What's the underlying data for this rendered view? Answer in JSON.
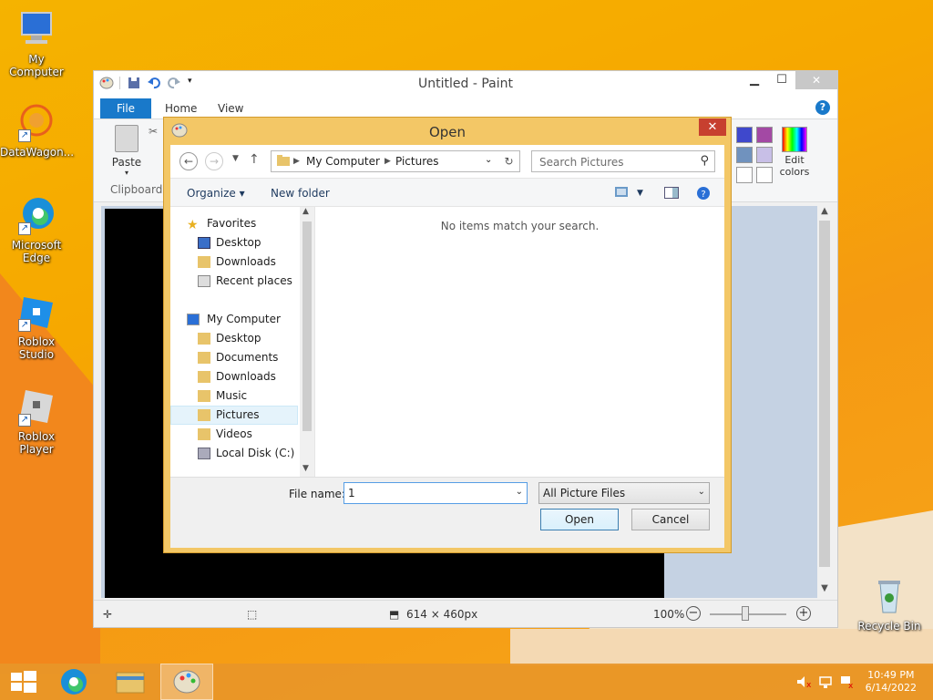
{
  "desktop": {
    "icons": [
      {
        "label": "My Computer"
      },
      {
        "label": "DataWagon..."
      },
      {
        "label": "Microsoft Edge"
      },
      {
        "label": "Roblox Studio"
      },
      {
        "label": "Roblox Player"
      },
      {
        "label": "Recycle Bin"
      }
    ]
  },
  "paint": {
    "title": "Untitled - Paint",
    "tabs": {
      "file": "File",
      "home": "Home",
      "view": "View"
    },
    "help": "?",
    "paste_label": "Paste",
    "clipboard_label": "Clipboard",
    "edit_colors": "Edit colors",
    "status": {
      "size": "614 × 460px",
      "zoom": "100%"
    }
  },
  "dialog": {
    "title": "Open",
    "close": "✕",
    "breadcrumb": [
      "My Computer",
      "Pictures"
    ],
    "search_placeholder": "Search Pictures",
    "organize": "Organize ▾",
    "new_folder": "New folder",
    "empty_message": "No items match your search.",
    "nav": {
      "favorites": "Favorites",
      "fav_items": [
        "Desktop",
        "Downloads",
        "Recent places"
      ],
      "computer": "My Computer",
      "comp_items": [
        "Desktop",
        "Documents",
        "Downloads",
        "Music",
        "Pictures",
        "Videos",
        "Local Disk (C:)"
      ]
    },
    "file_name_label": "File name:",
    "file_name_value": "1",
    "file_type": "All Picture Files",
    "open_button": "Open",
    "cancel_button": "Cancel"
  },
  "taskbar": {
    "time": "10:49 PM",
    "date": "6/14/2022"
  },
  "colors": {
    "accent": "#1979ca",
    "dialog_frame": "#f3c766",
    "close_red": "#c7402f"
  }
}
